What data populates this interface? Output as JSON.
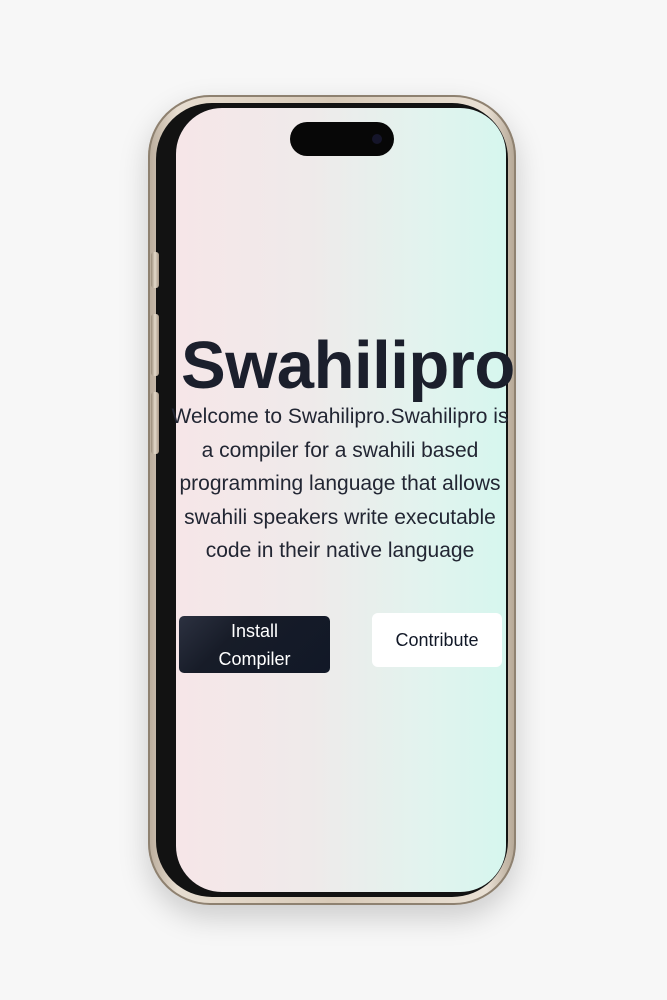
{
  "hero": {
    "title": "Swahilipro",
    "description": "Welcome to Swahilipro.Swahilipro is a compiler for a swahili based programming language that allows swahili speakers write executable code in their native language"
  },
  "actions": {
    "install_label": "Install Compiler",
    "contribute_label": "Contribute"
  },
  "colors": {
    "background": "#f7f7f7",
    "primary_button": "#111827",
    "secondary_button": "#ffffff",
    "text": "#1b1f2c"
  }
}
